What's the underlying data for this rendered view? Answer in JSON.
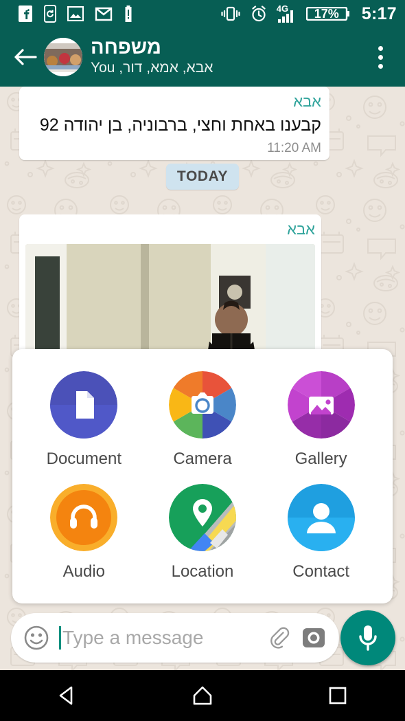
{
  "statusbar": {
    "icons": [
      "facebook-icon",
      "phone-sync-icon",
      "image-icon",
      "gmail-icon",
      "battery-alert-icon"
    ],
    "right_icons": [
      "vibrate-icon",
      "alarm-icon",
      "signal-4g-icon"
    ],
    "network_label": "4G",
    "battery_percent": "17%",
    "clock": "5:17"
  },
  "header": {
    "back_label": "Back",
    "group_name": "משפחה",
    "participants": "אבא, אמא, דור, You",
    "menu_label": "More options"
  },
  "chat": {
    "date_divider": "TODAY",
    "messages": [
      {
        "sender": "אבא",
        "text": "קבענו באחת וחצי, ברבוניה, בן יהודה 92",
        "time": "11:20 AM"
      },
      {
        "sender": "אבא",
        "text": "",
        "time": ""
      }
    ]
  },
  "attachment_panel": {
    "items": [
      {
        "label": "Document",
        "icon": "document-icon",
        "color": "#4B51B8"
      },
      {
        "label": "Camera",
        "icon": "camera-icon",
        "color": "#E8533A"
      },
      {
        "label": "Gallery",
        "icon": "gallery-icon",
        "color": "#C23BC6"
      },
      {
        "label": "Audio",
        "icon": "audio-icon",
        "color": "#F08A1E"
      },
      {
        "label": "Location",
        "icon": "location-icon",
        "color": "#12A45B"
      },
      {
        "label": "Contact",
        "icon": "contact-icon",
        "color": "#1FA2E8"
      }
    ]
  },
  "composer": {
    "emoji_icon": "emoji-smiley-icon",
    "placeholder": "Type a message",
    "attach_icon": "paperclip-icon",
    "camera_icon": "camera-icon",
    "mic_icon": "microphone-icon"
  },
  "navbar": {
    "back": "back-triangle-icon",
    "home": "home-icon",
    "recents": "recents-square-icon"
  },
  "colors": {
    "header_teal": "#075E54",
    "chat_bg": "#ECE5DD",
    "sender_teal": "#2FA39B",
    "date_chip": "#CFE3EF",
    "mic_green": "#00887A"
  }
}
